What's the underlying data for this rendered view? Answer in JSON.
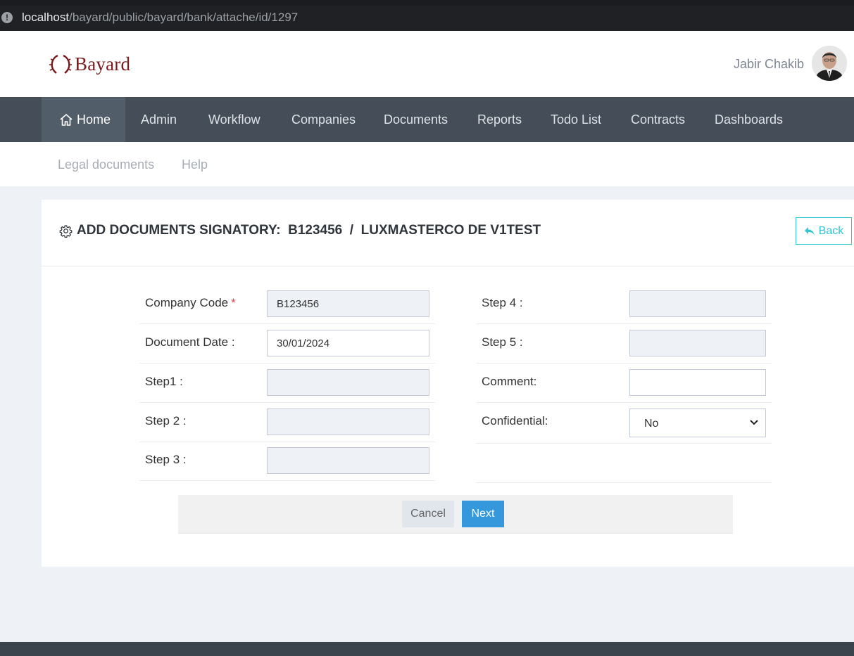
{
  "browser": {
    "url_host": "localhost",
    "url_path": "/bayard/public/bayard/bank/attache/id/1297"
  },
  "header": {
    "logo_text": "Bayard",
    "user_name": "Jabir Chakib"
  },
  "nav": {
    "items": [
      {
        "label": "Home",
        "active": true
      },
      {
        "label": "Admin"
      },
      {
        "label": "Workflow"
      },
      {
        "label": "Companies"
      },
      {
        "label": "Documents"
      },
      {
        "label": "Reports"
      },
      {
        "label": "Todo List"
      },
      {
        "label": "Contracts"
      },
      {
        "label": "Dashboards"
      }
    ],
    "sub_items": [
      {
        "label": "Legal documents"
      },
      {
        "label": "Help"
      }
    ]
  },
  "page": {
    "title": "ADD DOCUMENTS SIGNATORY:  B123456  /  LUXMASTERCO DE V1TEST",
    "back_label": "Back"
  },
  "form": {
    "left": [
      {
        "label": "Company Code",
        "required_mark": "*",
        "value": "B123456",
        "readonly": true
      },
      {
        "label": "Document Date :",
        "value": "30/01/2024",
        "readonly": false
      },
      {
        "label": "Step1 :",
        "value": "",
        "readonly": true
      },
      {
        "label": "Step 2 :",
        "value": "",
        "readonly": true
      },
      {
        "label": "Step 3 :",
        "value": "",
        "readonly": true
      }
    ],
    "right": [
      {
        "label": "Step 4 :",
        "value": "",
        "readonly": true
      },
      {
        "label": "Step 5 :",
        "value": "",
        "readonly": true
      },
      {
        "label": "Comment:",
        "value": "",
        "readonly": false
      },
      {
        "label": "Confidential:",
        "value": "No",
        "type": "select"
      }
    ],
    "cancel_label": "Cancel",
    "next_label": "Next"
  },
  "colors": {
    "nav_bg": "#444d58",
    "primary_button": "#3598dc",
    "back_button": "#32c5d2",
    "logo": "#7a1a1c"
  }
}
